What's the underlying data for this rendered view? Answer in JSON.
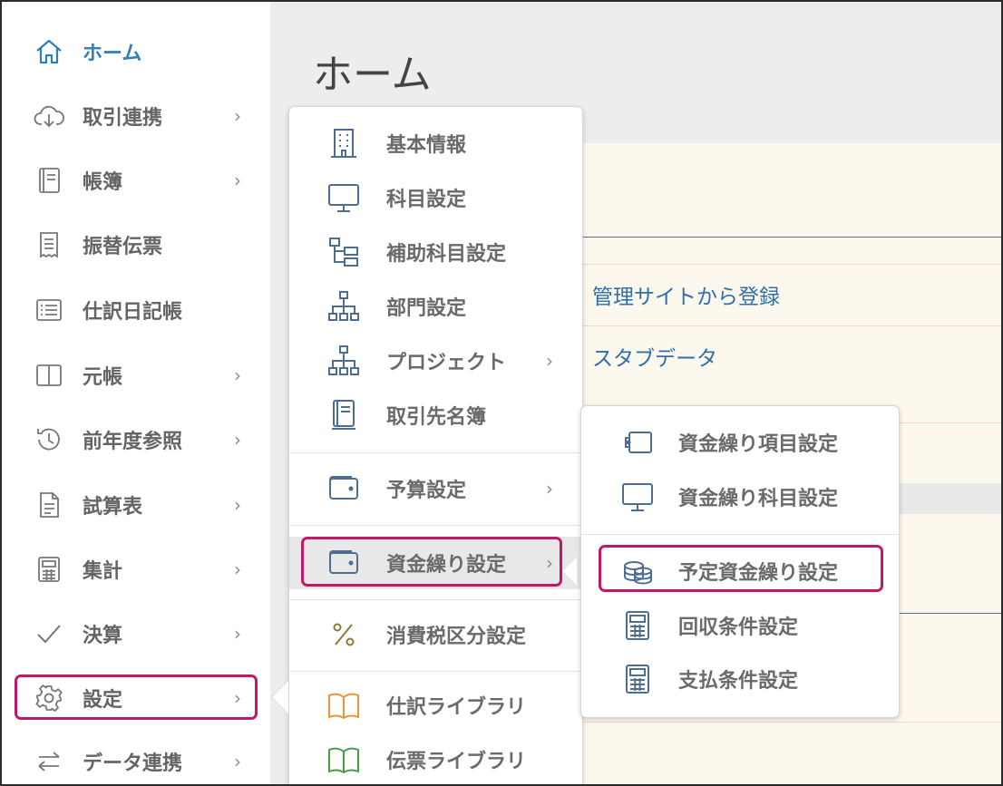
{
  "main": {
    "title": "ホーム",
    "links": [
      "管理サイトから登録",
      "スタブデータ"
    ]
  },
  "sidebar": {
    "items": [
      {
        "label": "ホーム",
        "icon": "home-icon",
        "chevron": false,
        "active": true
      },
      {
        "label": "取引連携",
        "icon": "cloud-download-icon",
        "chevron": true
      },
      {
        "label": "帳簿",
        "icon": "book-icon",
        "chevron": true
      },
      {
        "label": "振替伝票",
        "icon": "receipt-icon",
        "chevron": false
      },
      {
        "label": "仕訳日記帳",
        "icon": "list-icon",
        "chevron": false
      },
      {
        "label": "元帳",
        "icon": "ledger-icon",
        "chevron": true
      },
      {
        "label": "前年度参照",
        "icon": "history-icon",
        "chevron": true
      },
      {
        "label": "試算表",
        "icon": "document-icon",
        "chevron": true
      },
      {
        "label": "集計",
        "icon": "calculator-icon",
        "chevron": true
      },
      {
        "label": "決算",
        "icon": "check-icon",
        "chevron": true
      },
      {
        "label": "設定",
        "icon": "gear-icon",
        "chevron": true,
        "highlighted": true
      },
      {
        "label": "データ連携",
        "icon": "swap-icon",
        "chevron": true
      }
    ]
  },
  "settings_menu": {
    "items": [
      {
        "label": "基本情報",
        "icon": "building-icon"
      },
      {
        "label": "科目設定",
        "icon": "monitor-icon"
      },
      {
        "label": "補助科目設定",
        "icon": "sub-account-icon"
      },
      {
        "label": "部門設定",
        "icon": "org-chart-icon"
      },
      {
        "label": "プロジェクト",
        "icon": "org-chart-icon",
        "chevron": true
      },
      {
        "label": "取引先名簿",
        "icon": "address-book-icon"
      },
      {
        "label": "予算設定",
        "icon": "wallet-icon",
        "chevron": true
      },
      {
        "label": "資金繰り設定",
        "icon": "wallet-icon",
        "chevron": true,
        "selected": true
      },
      {
        "label": "消費税区分設定",
        "icon": "percent-icon"
      },
      {
        "label": "仕訳ライブラリ",
        "icon": "open-book-orange-icon"
      },
      {
        "label": "伝票ライブラリ",
        "icon": "open-book-green-icon"
      }
    ]
  },
  "cashflow_menu": {
    "items": [
      {
        "label": "資金繰り項目設定",
        "icon": "tag-icon"
      },
      {
        "label": "資金繰り科目設定",
        "icon": "monitor-icon"
      },
      {
        "label": "予定資金繰り設定",
        "icon": "coins-icon",
        "highlighted": true
      },
      {
        "label": "回収条件設定",
        "icon": "calculator-icon"
      },
      {
        "label": "支払条件設定",
        "icon": "calculator-icon"
      }
    ]
  },
  "colors": {
    "accent_blue": "#2f7fb8",
    "highlight_magenta": "#c2186a",
    "icon_blue": "#4d6d93",
    "orange": "#e8963a",
    "green": "#4f9a4f",
    "percent": "#8a7a3a"
  }
}
